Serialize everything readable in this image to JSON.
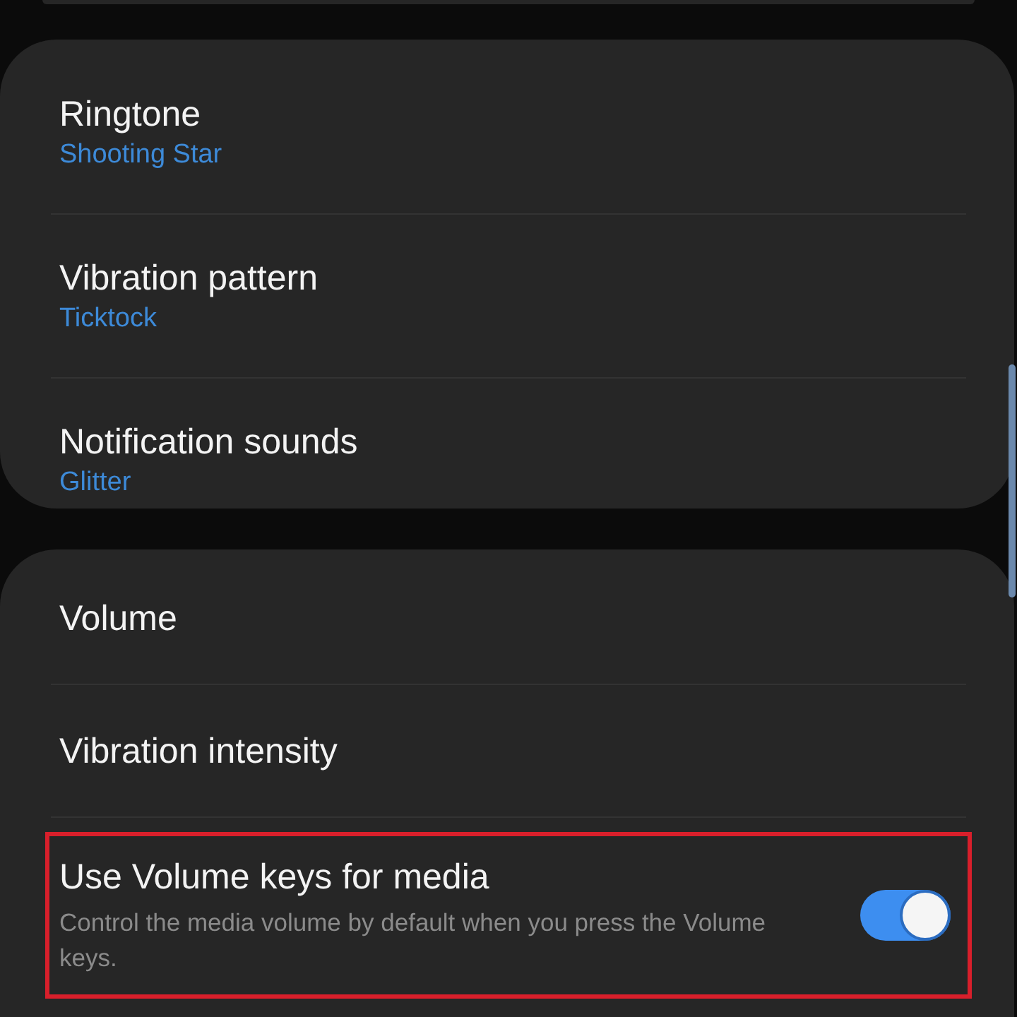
{
  "groups": [
    {
      "items": [
        {
          "kind": "value",
          "title": "Ringtone",
          "value": "Shooting Star"
        },
        {
          "kind": "value",
          "title": "Vibration pattern",
          "value": "Ticktock"
        },
        {
          "kind": "value",
          "title": "Notification sounds",
          "value": "Glitter"
        }
      ]
    },
    {
      "items": [
        {
          "kind": "plain",
          "title": "Volume"
        },
        {
          "kind": "plain",
          "title": "Vibration intensity"
        },
        {
          "kind": "switch",
          "title": "Use Volume keys for media",
          "description": "Control the media volume by default when you press the Volume keys.",
          "on": true,
          "highlighted": true
        }
      ]
    }
  ]
}
